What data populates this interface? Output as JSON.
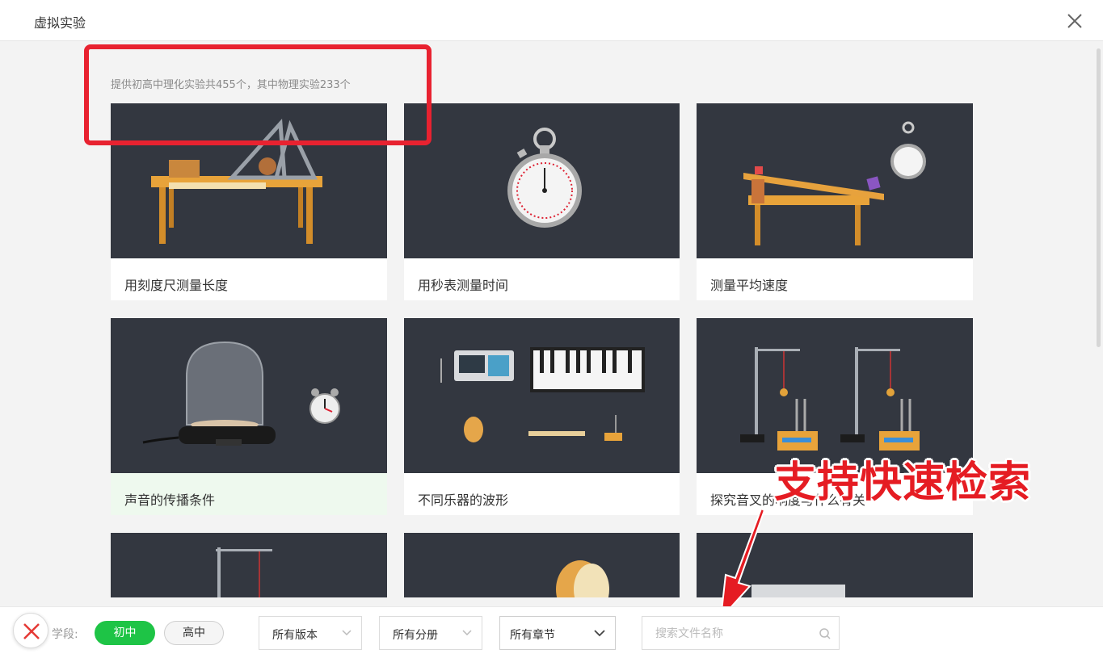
{
  "window": {
    "title": "虚拟实验"
  },
  "summary": "提供初高中理化实验共455个，其中物理实验233个",
  "experiments": [
    {
      "title": "用刻度尺测量长度",
      "icon": "ruler-table-illustration"
    },
    {
      "title": "用秒表测量时间",
      "icon": "stopwatch-illustration"
    },
    {
      "title": "测量平均速度",
      "icon": "incline-stopwatch-illustration"
    },
    {
      "title": "声音的传播条件",
      "icon": "bell-jar-illustration",
      "selected": true
    },
    {
      "title": "不同乐器的波形",
      "icon": "instruments-illustration"
    },
    {
      "title": "探究音叉的响度与什么有关",
      "icon": "tuning-fork-illustration"
    },
    {
      "title": "",
      "icon": "pendulum-stand-illustration"
    },
    {
      "title": "",
      "icon": "drum-illustration"
    },
    {
      "title": "",
      "icon": "device-illustration"
    }
  ],
  "annotation": {
    "callout": "支持快速检索"
  },
  "filters": {
    "stage_label": "学段:",
    "stage_options": [
      "初中",
      "高中"
    ],
    "stage_selected": "初中",
    "version": "所有版本",
    "volume": "所有分册",
    "chapter": "所有章节",
    "search_placeholder": "搜索文件名称"
  },
  "colors": {
    "accent": "#1ec446",
    "thumb_bg": "#333740",
    "annotation": "#e51c23",
    "selected_card": "#eef9ee"
  }
}
